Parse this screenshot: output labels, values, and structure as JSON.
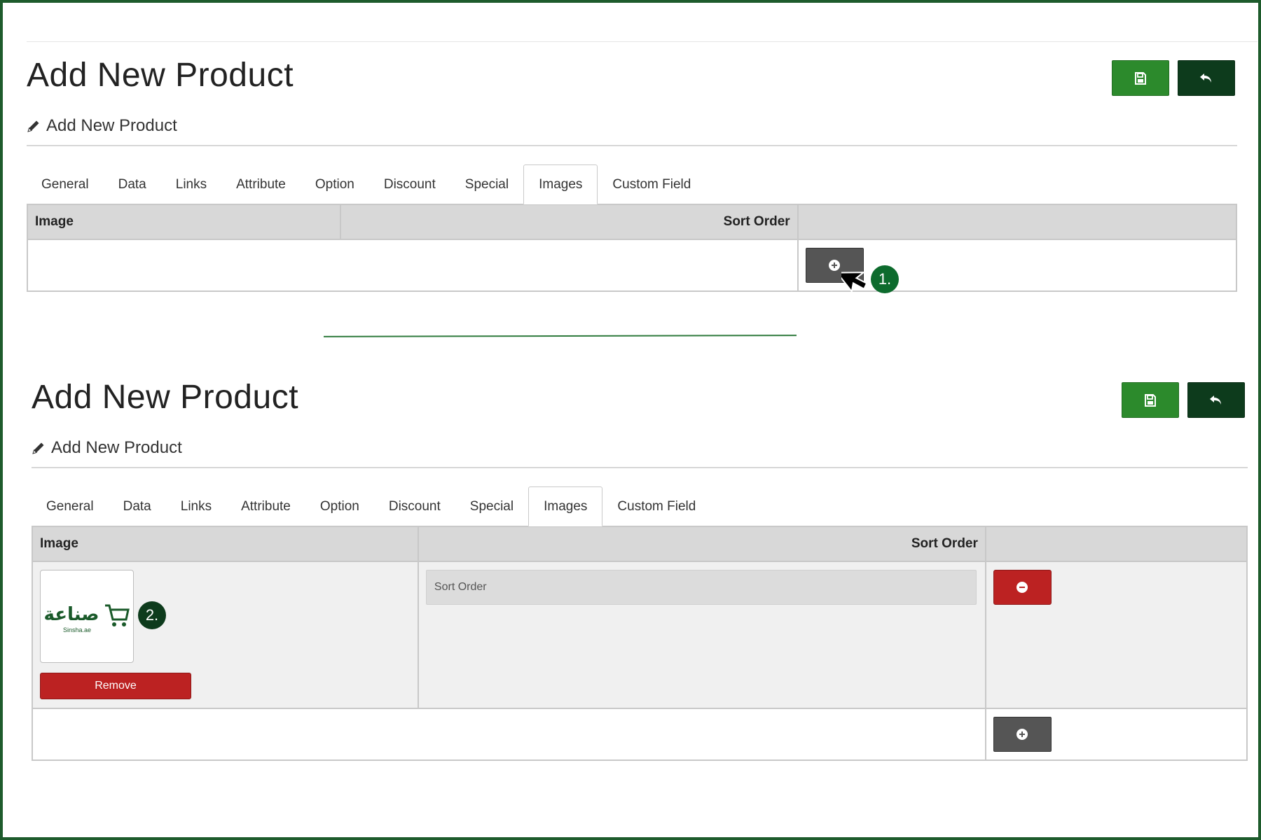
{
  "top": {
    "title": "Add New Product",
    "subtitle": "Add New Product",
    "tabs": [
      "General",
      "Data",
      "Links",
      "Attribute",
      "Option",
      "Discount",
      "Special",
      "Images",
      "Custom Field"
    ],
    "active_tab": "Images",
    "table": {
      "headers": {
        "image": "Image",
        "sort_order": "Sort Order"
      }
    },
    "step_badge": "1."
  },
  "bottom": {
    "title": "Add New Product",
    "subtitle": "Add New Product",
    "tabs": [
      "General",
      "Data",
      "Links",
      "Attribute",
      "Option",
      "Discount",
      "Special",
      "Images",
      "Custom Field"
    ],
    "active_tab": "Images",
    "table": {
      "headers": {
        "image": "Image",
        "sort_order": "Sort Order"
      },
      "row": {
        "logo_arabic": "صناعة",
        "logo_caption": "Sinsha.ae",
        "remove_label": "Remove",
        "sort_order_placeholder": "Sort Order"
      }
    },
    "step_badge": "2."
  },
  "icons": {
    "save": "floppy-disk-icon",
    "back": "reply-arrow-icon",
    "edit": "pencil-icon",
    "add": "plus-circle-icon",
    "remove_row": "minus-circle-icon",
    "cursor": "mouse-pointer-icon",
    "cart": "shopping-cart-icon"
  },
  "colors": {
    "save": "#2c8a2c",
    "back": "#0d3b1c",
    "danger": "#bc2222",
    "add": "#555555",
    "badge": "#0d6b2d",
    "frame": "#1e5b2c"
  }
}
